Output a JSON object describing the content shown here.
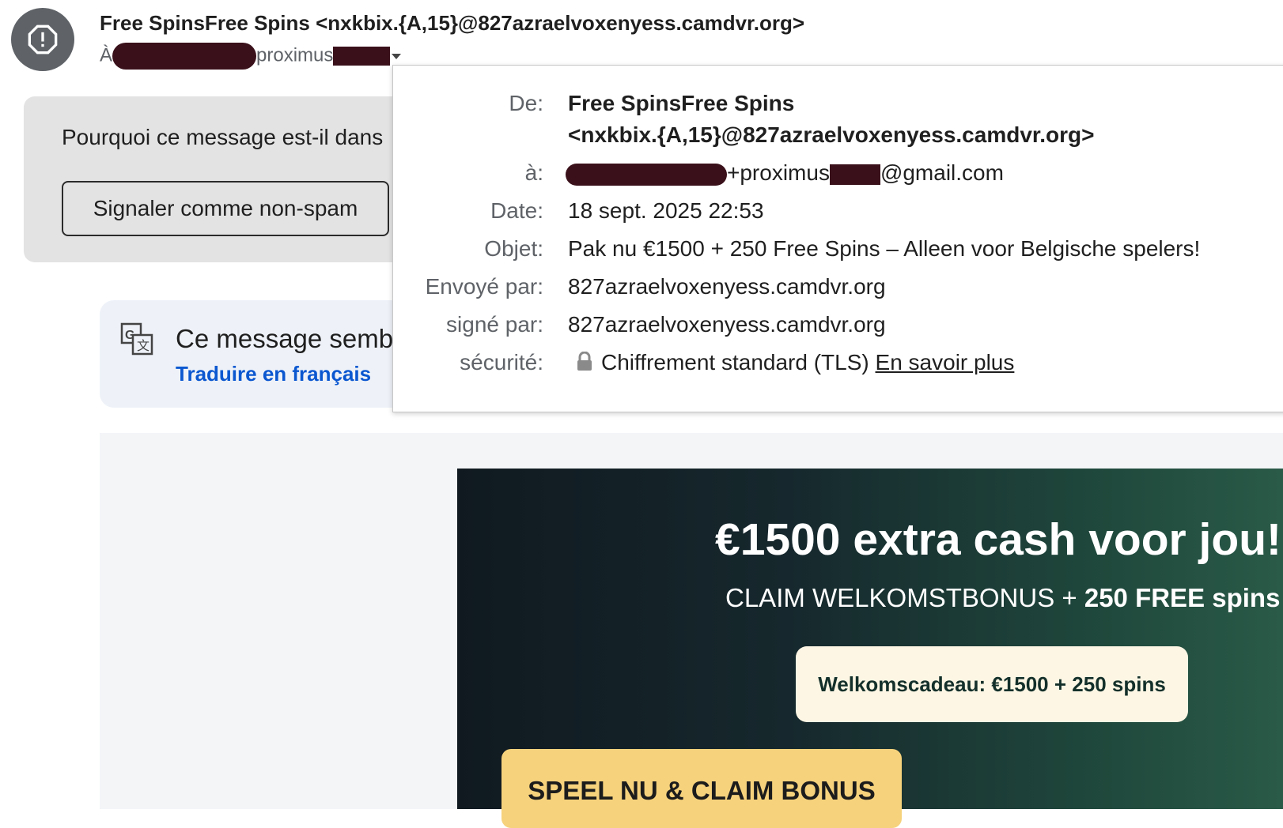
{
  "header": {
    "sender_display": "Free SpinsFree Spins <nxkbix.{A,15}@827azraelvoxenyess.camdvr.org>",
    "to_prefix": "À",
    "to_visible": "proximus"
  },
  "spam_banner": {
    "question": "Pourquoi ce message est-il dans",
    "not_spam_label": "Signaler comme non-spam"
  },
  "translate_banner": {
    "message": "Ce message semb",
    "link": "Traduire en français"
  },
  "details": {
    "from_label": "De:",
    "from_name": "Free SpinsFree Spins",
    "from_address": "<nxkbix.{A,15}@827azraelvoxenyess.camdvr.org>",
    "to_label": "à:",
    "to_part1": "+proximus",
    "to_part2": "@gmail.com",
    "date_label": "Date:",
    "date_value": "18 sept. 2025 22:53",
    "subject_label": "Objet:",
    "subject_value": "Pak nu €1500 + 250 Free Spins – Alleen voor Belgische spelers!",
    "mailed_by_label": "Envoyé par:",
    "mailed_by_value": "827azraelvoxenyess.camdvr.org",
    "signed_by_label": "signé par:",
    "signed_by_value": "827azraelvoxenyess.camdvr.org",
    "security_label": "sécurité:",
    "security_value": "Chiffrement standard (TLS)",
    "learn_more": "En savoir plus"
  },
  "promo": {
    "headline": "€1500 extra cash voor jou!",
    "sub_regular": "CLAIM WELKOMSTBONUS + ",
    "sub_bold": "250 FREE spins",
    "gift": "Welkomscadeau: €1500 + 250 spins",
    "cta": "SPEEL NU & CLAIM BONUS"
  },
  "colors": {
    "redaction": "#3a111b",
    "link_blue": "#0b57d0",
    "cta_yellow": "#f6d27c",
    "promo_dark": "#101920",
    "promo_green": "#2a5a48"
  },
  "icons": [
    "alert-octagon-icon",
    "translate-icon",
    "lock-icon",
    "chevron-down-icon"
  ]
}
